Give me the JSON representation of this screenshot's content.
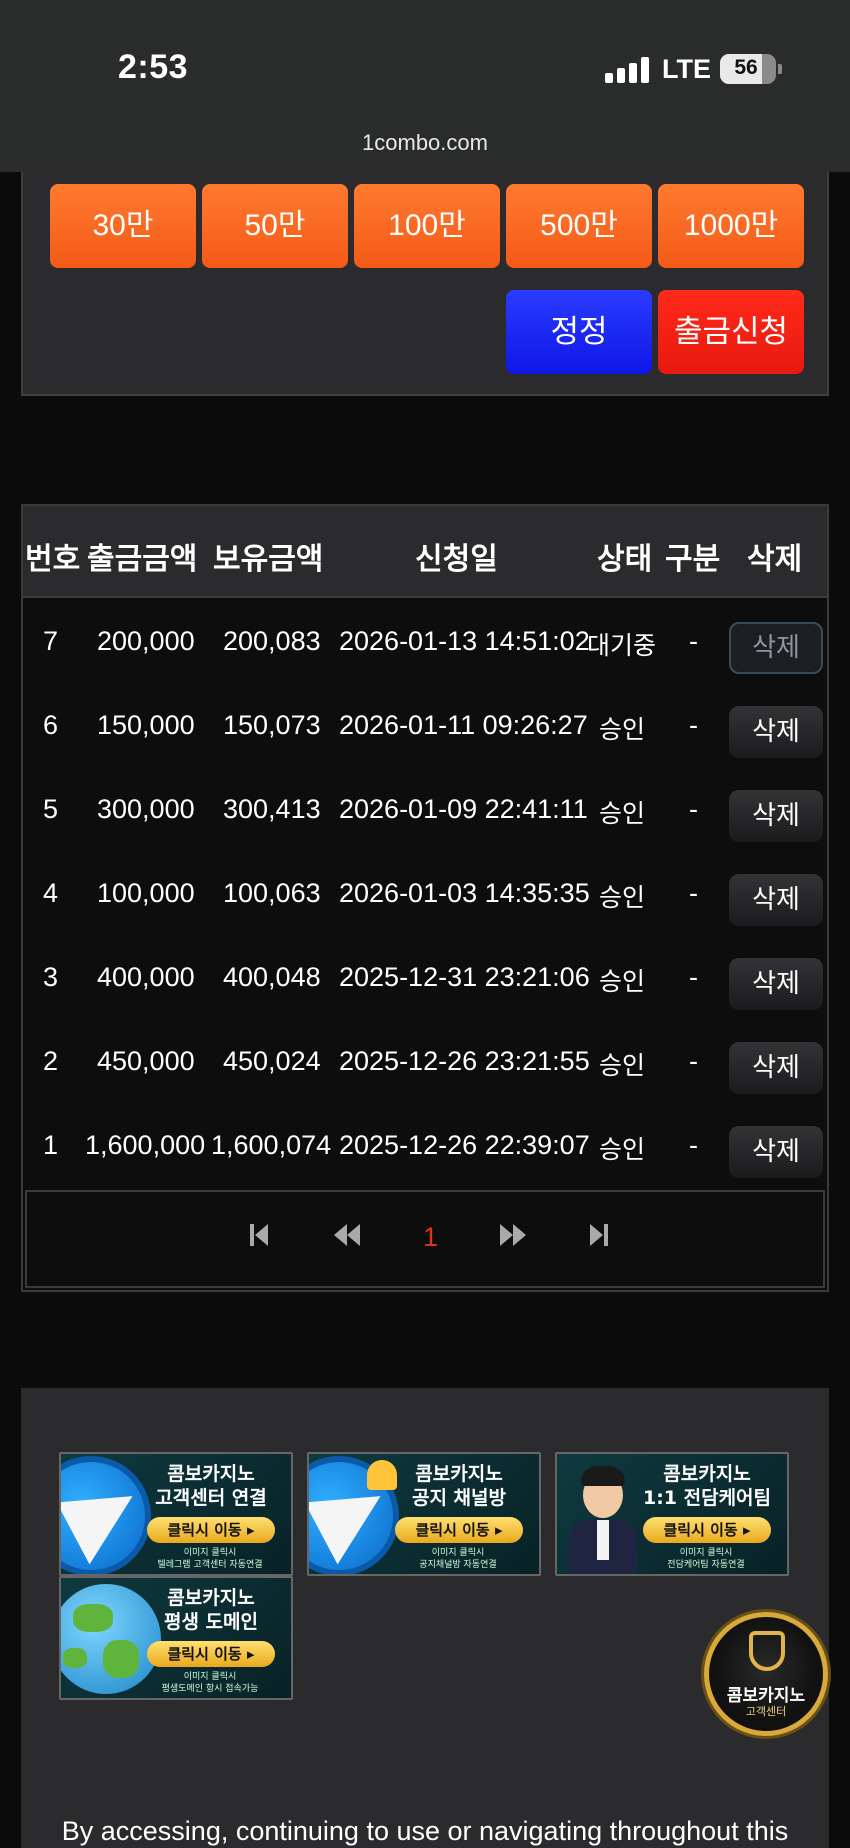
{
  "status_bar": {
    "time": "2:53",
    "network": "LTE",
    "battery": "56",
    "url": "1combo.com"
  },
  "amount_buttons": [
    "30만",
    "50만",
    "100만",
    "500만",
    "1000만"
  ],
  "actions": {
    "reset": "정정",
    "withdraw": "출금신청"
  },
  "table": {
    "headers": [
      "번호",
      "출금금액",
      "보유금액",
      "신청일",
      "상태",
      "구분",
      "삭제"
    ],
    "rows": [
      {
        "no": "7",
        "amount": "200,000",
        "balance": "200,083",
        "date": "2026-01-13 14:51:02",
        "status": "대기중",
        "type": "-",
        "delete": "삭제",
        "pending": true
      },
      {
        "no": "6",
        "amount": "150,000",
        "balance": "150,073",
        "date": "2026-01-11 09:26:27",
        "status": "승인",
        "type": "-",
        "delete": "삭제",
        "pending": false
      },
      {
        "no": "5",
        "amount": "300,000",
        "balance": "300,413",
        "date": "2026-01-09 22:41:11",
        "status": "승인",
        "type": "-",
        "delete": "삭제",
        "pending": false
      },
      {
        "no": "4",
        "amount": "100,000",
        "balance": "100,063",
        "date": "2026-01-03 14:35:35",
        "status": "승인",
        "type": "-",
        "delete": "삭제",
        "pending": false
      },
      {
        "no": "3",
        "amount": "400,000",
        "balance": "400,048",
        "date": "2025-12-31 23:21:06",
        "status": "승인",
        "type": "-",
        "delete": "삭제",
        "pending": false
      },
      {
        "no": "2",
        "amount": "450,000",
        "balance": "450,024",
        "date": "2025-12-26 23:21:55",
        "status": "승인",
        "type": "-",
        "delete": "삭제",
        "pending": false
      },
      {
        "no": "1",
        "amount": "1,600,000",
        "balance": "1,600,074",
        "date": "2025-12-26 22:39:07",
        "status": "승인",
        "type": "-",
        "delete": "삭제",
        "pending": false
      }
    ]
  },
  "pagination": {
    "current_page": "1"
  },
  "banners": [
    {
      "title1": "콤보카지노",
      "title2": "고객센터 연결",
      "button": "클릭시 이동 ▸",
      "note1": "이미지 클릭시",
      "note2": "텔레그램 고객센터 자동연결",
      "icon": "telegram-icon"
    },
    {
      "title1": "콤보카지노",
      "title2": "공지 채널방",
      "button": "클릭시 이동 ▸",
      "note1": "이미지 클릭시",
      "note2": "공지채널방 자동연결",
      "icon": "telegram-bell-icon"
    },
    {
      "title1": "콤보카지노",
      "title2": "1:1 전담케어팀",
      "button": "클릭시 이동 ▸",
      "note1": "이미지 클릭시",
      "note2": "전담케어팀 자동연결",
      "icon": "agent-avatar-icon"
    },
    {
      "title1": "콤보카지노",
      "title2": "평생 도메인",
      "button": "클릭시 이동 ▸",
      "note1": "이미지 클릭시",
      "note2": "평생도메인 항시 접속가능",
      "icon": "globe-icon"
    }
  ],
  "support_badge": {
    "line1": "콤보카지노",
    "line2": "고객센터"
  },
  "legal_text": "By accessing, continuing to use or navigating throughout this",
  "colors": {
    "orange": "#f35a17",
    "blue": "#0f17e6",
    "red": "#e8190f",
    "page_bg": "#0b0b0c",
    "panel_bg": "#2b2b2d",
    "current_page": "#e0301e"
  }
}
